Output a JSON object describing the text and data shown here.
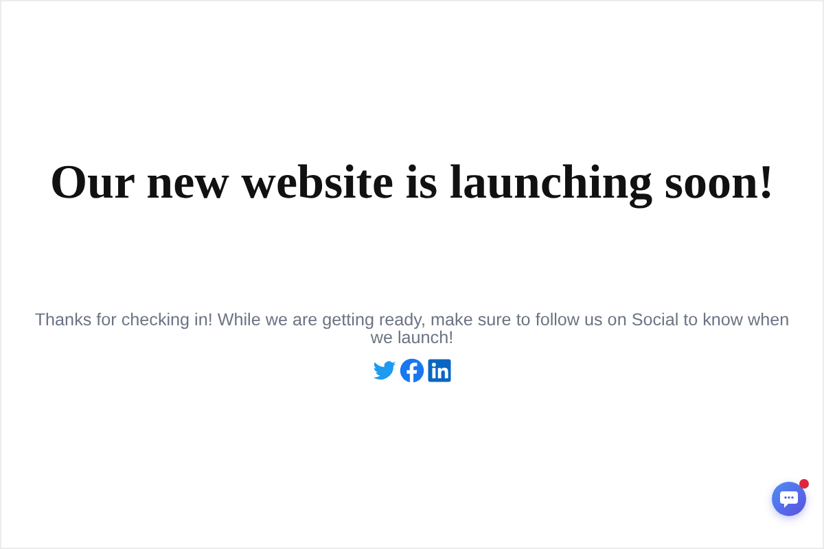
{
  "heading": "Our new website is launching soon!",
  "message": "Thanks for checking in! While we are getting ready, make sure to follow us on Social to know when we launch!",
  "social_links": [
    {
      "kind": "twitter"
    },
    {
      "kind": "facebook"
    },
    {
      "kind": "linkedin"
    }
  ],
  "chat_button": {
    "unread": true
  }
}
